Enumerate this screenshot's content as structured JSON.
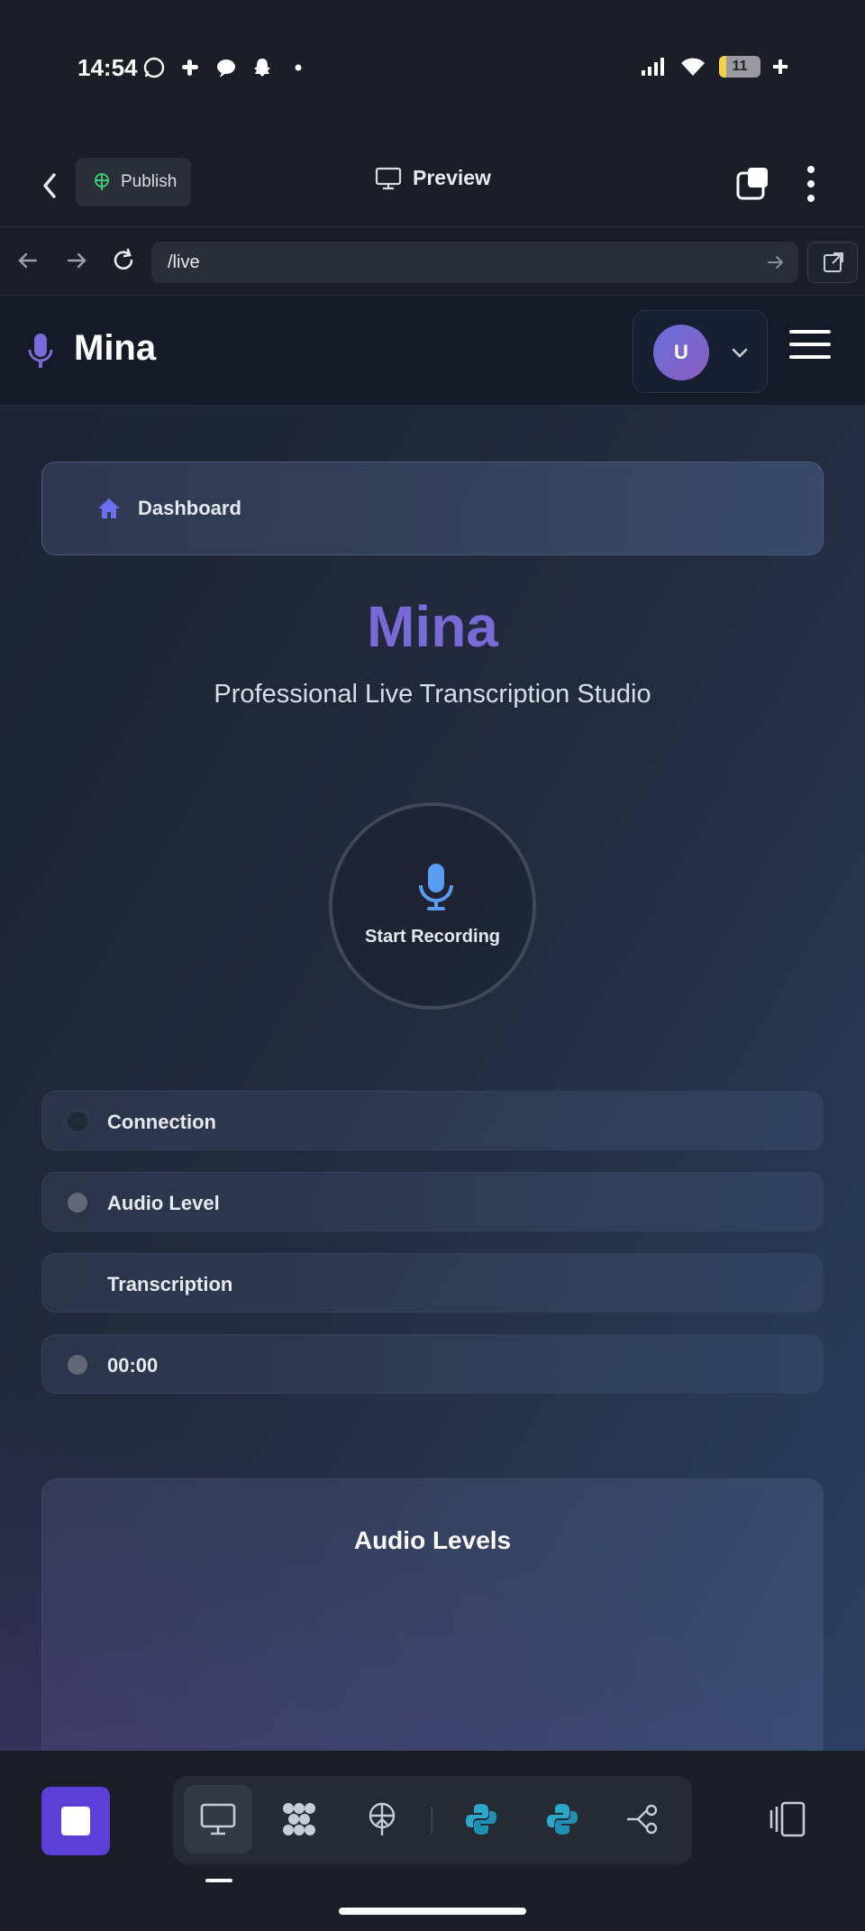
{
  "status_bar": {
    "time": "14:54",
    "notification_icons": [
      "whatsapp-icon",
      "slack-icon",
      "chat-bubble-icon",
      "snapchat-icon",
      "dot-icon"
    ],
    "battery": "11"
  },
  "toolbar": {
    "publish_label": "Publish",
    "preview_label": "Preview"
  },
  "browser": {
    "url": "/live"
  },
  "site": {
    "logo_text": "Mina",
    "avatar_initial": "U",
    "breadcrumb_label": "Dashboard",
    "hero_title": "Mina",
    "hero_subtitle": "Professional Live Transcription Studio",
    "record_label": "Start Recording",
    "status_rows": [
      {
        "label": "Connection"
      },
      {
        "label": "Audio Level"
      },
      {
        "label": "Transcription"
      },
      {
        "label": "00:00"
      }
    ],
    "audio_levels_title": "Audio Levels"
  },
  "colors": {
    "accent": "#7a6ad6",
    "stop_button": "#5b3fd8",
    "mic_blue": "#5a9cf0"
  }
}
